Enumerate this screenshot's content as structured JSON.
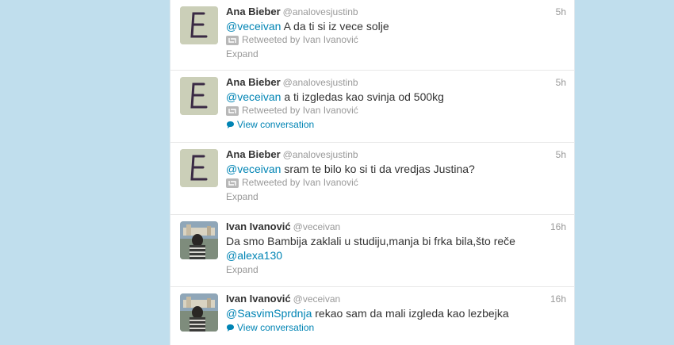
{
  "colors": {
    "background": "#c0deed",
    "link": "#0084b4",
    "muted": "#999999",
    "text": "#333333"
  },
  "tweets": [
    {
      "name": "Ana Bieber",
      "handle": "@analovesjustinb",
      "time": "5h",
      "mention": "@veceivan",
      "text": " A da ti si iz vece solje",
      "mention2": "",
      "retweeted_by": "Retweeted by Ivan Ivanović",
      "action": "Expand",
      "avatar": "letter-e-avatar"
    },
    {
      "name": "Ana Bieber",
      "handle": "@analovesjustinb",
      "time": "5h",
      "mention": "@veceivan",
      "text": " a ti izgledas kao svinja od 500kg",
      "mention2": "",
      "retweeted_by": "Retweeted by Ivan Ivanović",
      "action": "View conversation",
      "avatar": "letter-e-avatar"
    },
    {
      "name": "Ana Bieber",
      "handle": "@analovesjustinb",
      "time": "5h",
      "mention": "@veceivan",
      "text": " sram te bilo ko si ti da vredjas Justina?",
      "mention2": "",
      "retweeted_by": "Retweeted by Ivan Ivanović",
      "action": "Expand",
      "avatar": "letter-e-avatar"
    },
    {
      "name": "Ivan Ivanović",
      "handle": "@veceivan",
      "time": "16h",
      "mention": "",
      "text": "Da smo Bambija zaklali u studiju,manja bi frka bila,što reče",
      "mention2": "@alexa130",
      "retweeted_by": "",
      "action": "Expand",
      "avatar": "photo-avatar"
    },
    {
      "name": "Ivan Ivanović",
      "handle": "@veceivan",
      "time": "16h",
      "mention": "@SasvimSprdnja",
      "text": " rekao sam da mali izgleda kao lezbejka",
      "mention2": "",
      "retweeted_by": "",
      "action": "View conversation",
      "avatar": "photo-avatar"
    }
  ]
}
